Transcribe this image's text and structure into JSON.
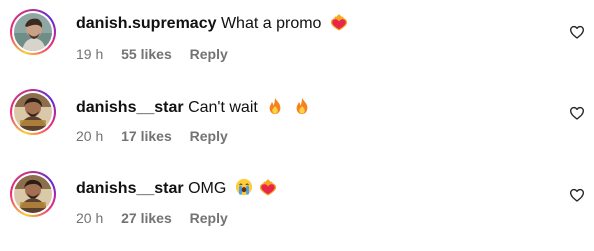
{
  "comments": [
    {
      "username": "danish.supremacy",
      "text": "What a promo",
      "emojis": [
        "heart-on-fire"
      ],
      "time": "19 h",
      "likes": "55 likes",
      "reply": "Reply"
    },
    {
      "username": "danishs__star",
      "text": "Can't wait",
      "emojis": [
        "fire",
        "fire"
      ],
      "time": "20 h",
      "likes": "17 likes",
      "reply": "Reply"
    },
    {
      "username": "danishs__star",
      "text": "OMG",
      "emojis": [
        "loudly-crying-face",
        "heart-on-fire"
      ],
      "time": "20 h",
      "likes": "27 likes",
      "reply": "Reply"
    }
  ],
  "colors": {
    "meta_gray": "#737373",
    "story_ring": [
      "#f9ce34",
      "#ee2a7b",
      "#6228d7"
    ]
  }
}
